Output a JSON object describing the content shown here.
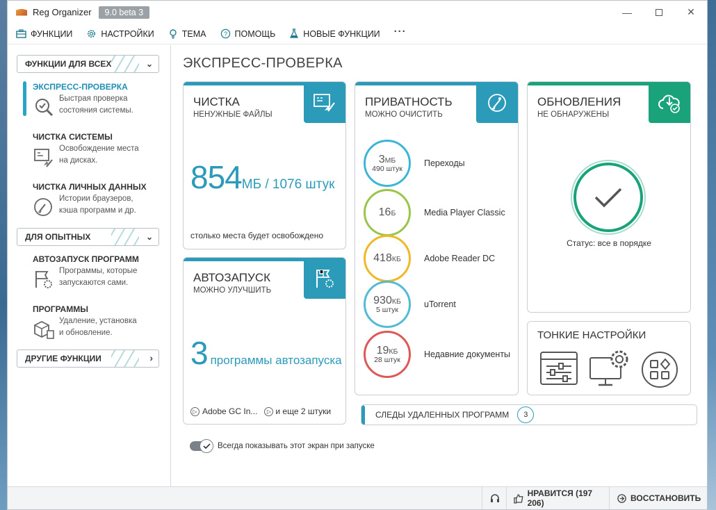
{
  "titlebar": {
    "app_name": "Reg Organizer",
    "version": "9.0 beta 3"
  },
  "menu": [
    {
      "label": "ФУНКЦИИ",
      "icon": "toolbox-icon"
    },
    {
      "label": "НАСТРОЙКИ",
      "icon": "gear-icon"
    },
    {
      "label": "ТЕМА",
      "icon": "lightbulb-icon"
    },
    {
      "label": "ПОМОЩЬ",
      "icon": "help-icon"
    },
    {
      "label": "НОВЫЕ ФУНКЦИИ",
      "icon": "flask-icon"
    }
  ],
  "sidebar": {
    "section_all": "ФУНКЦИИ ДЛЯ ВСЕХ",
    "section_advanced": "ДЛЯ ОПЫТНЫХ",
    "section_other": "ДРУГИЕ ФУНКЦИИ",
    "items": [
      {
        "title": "ЭКСПРЕСС-ПРОВЕРКА",
        "desc1": "Быстрая проверка",
        "desc2": "состояния системы."
      },
      {
        "title": "ЧИСТКА СИСТЕМЫ",
        "desc1": "Освобождение места",
        "desc2": "на дисках."
      },
      {
        "title": "ЧИСТКА ЛИЧНЫХ ДАННЫХ",
        "desc1": "Истории браузеров,",
        "desc2": "кэша программ и др."
      },
      {
        "title": "АВТОЗАПУСК ПРОГРАММ",
        "desc1": "Программы, которые",
        "desc2": "запускаются сами."
      },
      {
        "title": "ПРОГРАММЫ",
        "desc1": "Удаление, установка",
        "desc2": "и обновление."
      }
    ]
  },
  "main": {
    "title": "ЭКСПРЕСС-ПРОВЕРКА",
    "cleanup": {
      "title": "ЧИСТКА",
      "sub": "НЕНУЖНЫЕ ФАЙЛЫ",
      "size": "854",
      "size_unit": "МБ / 1076 штук",
      "foot": "столько места будет освобождено"
    },
    "autorun": {
      "title": "АВТОЗАПУСК",
      "sub": "МОЖНО УЛУЧШИТЬ",
      "count": "3",
      "count_label": "программы автозапуска",
      "item1": "Adobe GC In...",
      "item2": "и еще 2 штуки"
    },
    "privacy": {
      "title": "ПРИВАТНОСТЬ",
      "sub": "МОЖНО ОЧИСТИТЬ",
      "rows": [
        {
          "value": "3",
          "unit": "МБ",
          "count": "490 штук",
          "label": "Переходы",
          "color": "#3cb5d6"
        },
        {
          "value": "16",
          "unit": "Б",
          "count": "",
          "label": "Media Player Classic",
          "color": "#9bc54a"
        },
        {
          "value": "418",
          "unit": "КБ",
          "count": "",
          "label": "Adobe Reader DC",
          "color": "#f0b829"
        },
        {
          "value": "930",
          "unit": "КБ",
          "count": "5 штук",
          "label": "uTorrent",
          "color": "#52bcd6"
        },
        {
          "value": "19",
          "unit": "КБ",
          "count": "28 штук",
          "label": "Недавние документы",
          "color": "#dd5858"
        }
      ]
    },
    "updates": {
      "title": "ОБНОВЛЕНИЯ",
      "sub": "НЕ ОБНАРУЖЕНЫ",
      "status": "Статус: все в порядке"
    },
    "tweaks": {
      "title": "ТОНКИЕ НАСТРОЙКИ"
    },
    "traces": {
      "label": "СЛЕДЫ УДАЛЕННЫХ ПРОГРАММ",
      "count": "3"
    },
    "toggle_label": "Всегда показывать этот экран при запуске"
  },
  "statusbar": {
    "like": "НРАВИТСЯ (197 206)",
    "restore": "ВОССТАНОВИТЬ"
  },
  "colors": {
    "accent": "#2c9ab9",
    "green": "#1aa37a"
  }
}
